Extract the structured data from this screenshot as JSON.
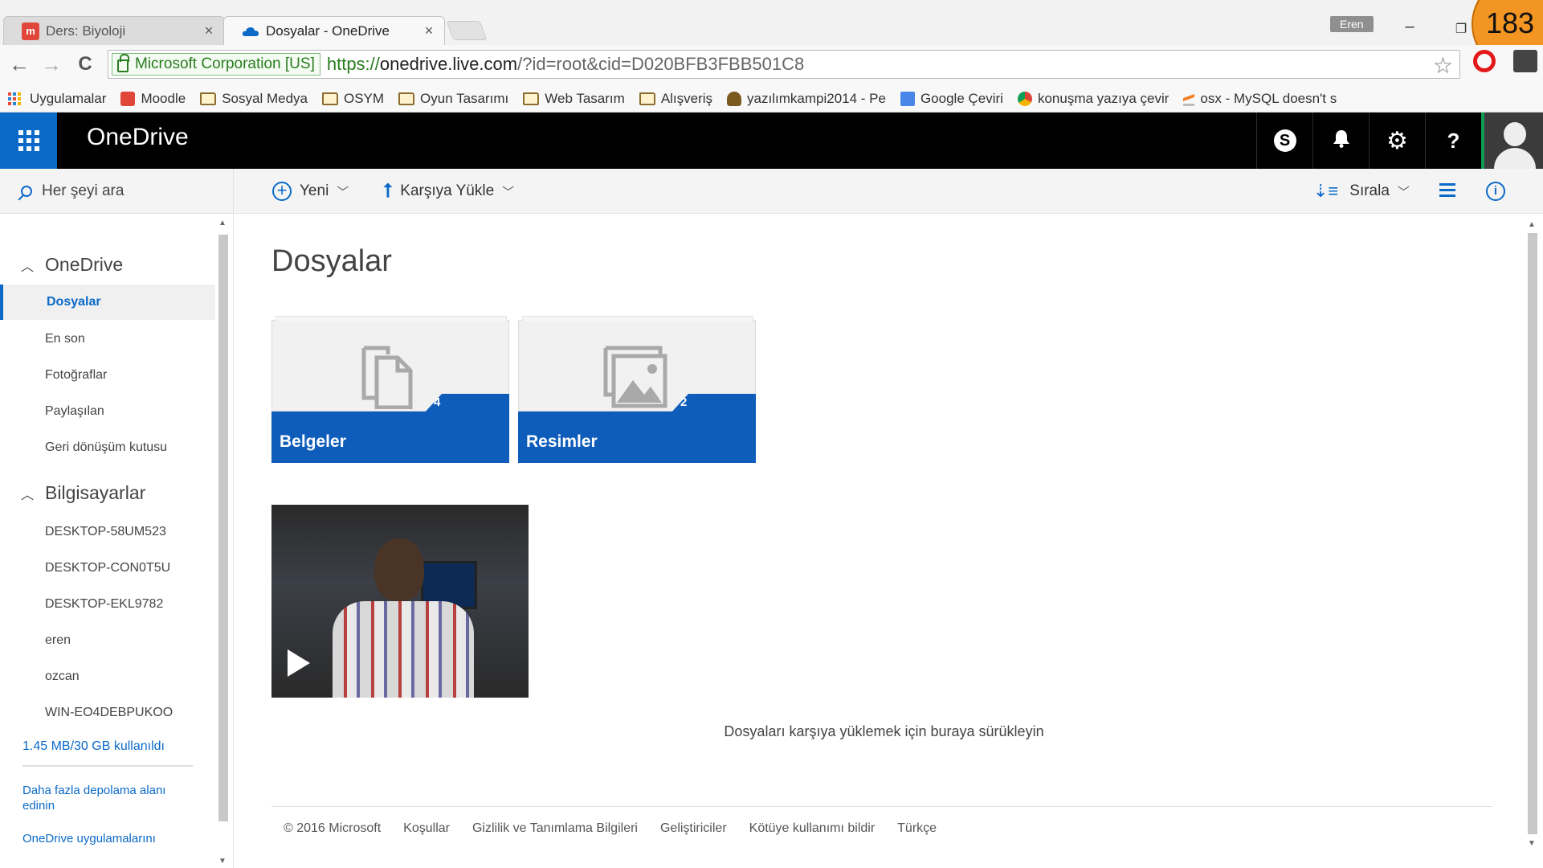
{
  "browser": {
    "tabs": [
      {
        "title": "Ders: Biyoloji",
        "active": false,
        "favicon": "moodle-icon"
      },
      {
        "title": "Dosyalar - OneDrive",
        "active": true,
        "favicon": "onedrive-cloud-icon"
      }
    ],
    "profile_name": "Eren",
    "counter_badge": "183",
    "window_controls": {
      "minimize": "–",
      "restore": "❐"
    },
    "nav": {
      "back": "←",
      "forward": "→",
      "reload": "C"
    },
    "ev_label": "Microsoft Corporation [US]",
    "url": {
      "scheme": "https://",
      "host": "onedrive.live.com",
      "path": "/?id=root&cid=D020BFB3FBB501C8"
    },
    "bookmarks": [
      {
        "label": "Uygulamalar",
        "icon": "apps-grid-icon"
      },
      {
        "label": "Moodle",
        "icon": "moodle-icon"
      },
      {
        "label": "Sosyal Medya",
        "icon": "folder-icon"
      },
      {
        "label": "OSYM",
        "icon": "folder-icon"
      },
      {
        "label": "Oyun Tasarımı",
        "icon": "folder-icon"
      },
      {
        "label": "Web Tasarım",
        "icon": "folder-icon"
      },
      {
        "label": "Alışveriş",
        "icon": "folder-icon"
      },
      {
        "label": "yazılımkampi2014 - Pe",
        "icon": "site-icon"
      },
      {
        "label": "Google Çeviri",
        "icon": "google-translate-icon"
      },
      {
        "label": "konuşma yazıya çevir",
        "icon": "chrome-icon"
      },
      {
        "label": "osx - MySQL doesn't s",
        "icon": "stackoverflow-icon"
      }
    ]
  },
  "header": {
    "brand": "OneDrive",
    "buttons": [
      {
        "name": "skype-button",
        "glyph": "S"
      },
      {
        "name": "notifications-button",
        "glyph": "🔔"
      },
      {
        "name": "settings-button",
        "glyph": "⚙"
      },
      {
        "name": "help-button",
        "glyph": "?"
      }
    ]
  },
  "sidebar": {
    "search_placeholder": "Her şeyi ara",
    "sections": [
      {
        "label": "OneDrive",
        "items": [
          "Dosyalar",
          "En son",
          "Fotoğraflar",
          "Paylaşılan",
          "Geri dönüşüm kutusu"
        ],
        "selected": "Dosyalar"
      },
      {
        "label": "Bilgisayarlar",
        "items": [
          "DESKTOP-58UM523",
          "DESKTOP-CON0T5U",
          "DESKTOP-EKL9782",
          "eren",
          "ozcan",
          "WIN-EO4DEBPUKOO"
        ]
      }
    ],
    "quota": "1.45 MB/30 GB kullanıldı",
    "links": [
      "Daha fazla depolama alanı edinin",
      "OneDrive uygulamalarını"
    ]
  },
  "commandbar": {
    "new_label": "Yeni",
    "upload_label": "Karşıya Yükle",
    "sort_label": "Sırala"
  },
  "main": {
    "title": "Dosyalar",
    "folders": [
      {
        "name": "Belgeler",
        "count": "4",
        "icon": "documents-icon"
      },
      {
        "name": "Resimler",
        "count": "2",
        "icon": "pictures-icon"
      }
    ],
    "video": {
      "icon": "play-icon"
    },
    "dropzone_text": "Dosyaları karşıya yüklemek için buraya sürükleyin"
  },
  "footer": [
    "© 2016 Microsoft",
    "Koşullar",
    "Gizlilik ve Tanımlama Bilgileri",
    "Geliştiriciler",
    "Kötüye kullanımı bildir",
    "Türkçe"
  ],
  "colors": {
    "accent": "#0b6ac8",
    "tile_band": "#0f5dbb",
    "header_bg": "#000000",
    "ev_green": "#2a7d1f"
  }
}
